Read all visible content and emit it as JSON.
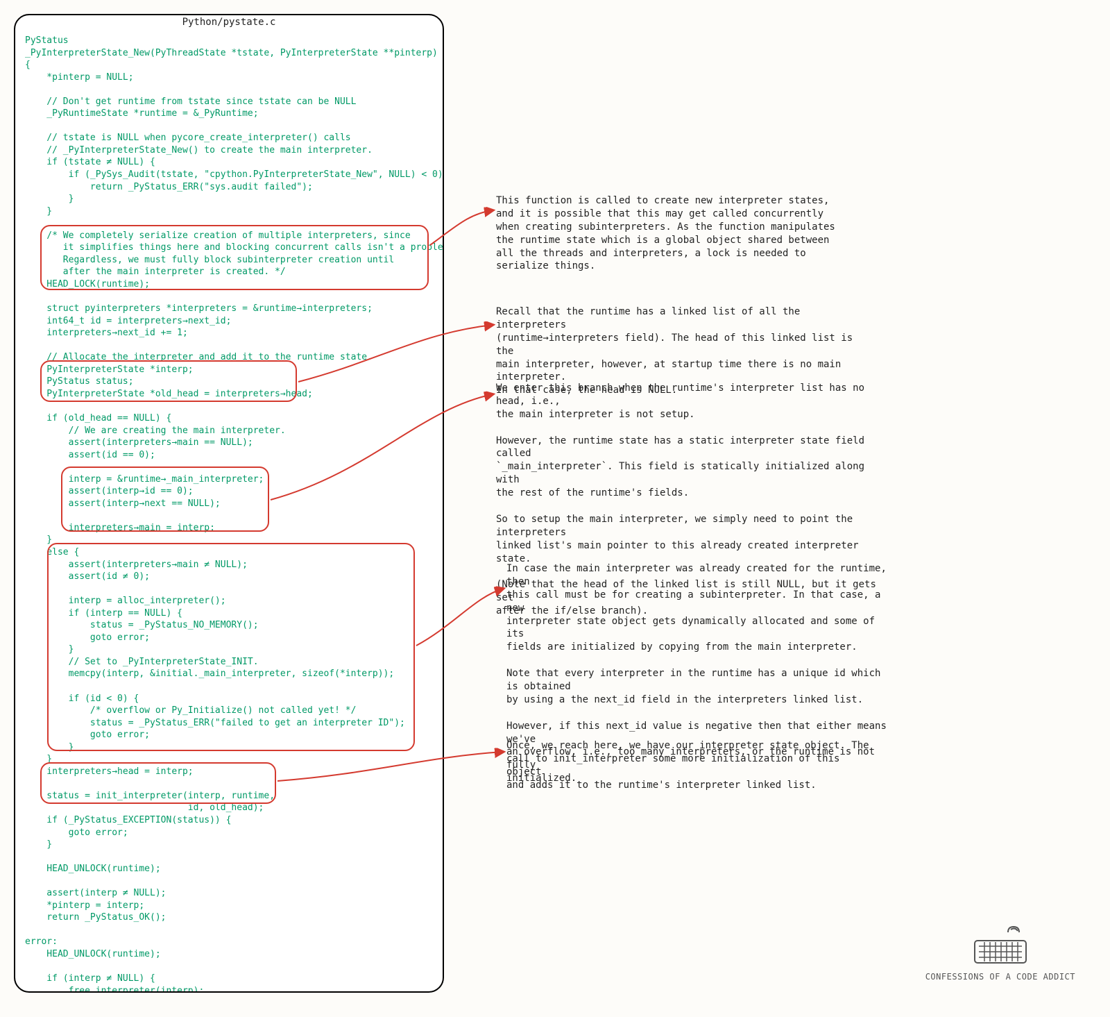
{
  "file_title": "Python/pystate.c",
  "code": "PyStatus\n_PyInterpreterState_New(PyThreadState *tstate, PyInterpreterState **pinterp)\n{\n    *pinterp = NULL;\n\n    // Don't get runtime from tstate since tstate can be NULL\n    _PyRuntimeState *runtime = &_PyRuntime;\n\n    // tstate is NULL when pycore_create_interpreter() calls\n    // _PyInterpreterState_New() to create the main interpreter.\n    if (tstate ≠ NULL) {\n        if (_PySys_Audit(tstate, \"cpython.PyInterpreterState_New\", NULL) < 0) {\n            return _PyStatus_ERR(\"sys.audit failed\");\n        }\n    }\n\n    /* We completely serialize creation of multiple interpreters, since\n       it simplifies things here and blocking concurrent calls isn't a problem.\n       Regardless, we must fully block subinterpreter creation until\n       after the main interpreter is created. */\n    HEAD_LOCK(runtime);\n\n    struct pyinterpreters *interpreters = &runtime→interpreters;\n    int64_t id = interpreters→next_id;\n    interpreters→next_id += 1;\n\n    // Allocate the interpreter and add it to the runtime state.\n    PyInterpreterState *interp;\n    PyStatus status;\n    PyInterpreterState *old_head = interpreters→head;\n\n    if (old_head == NULL) {\n        // We are creating the main interpreter.\n        assert(interpreters→main == NULL);\n        assert(id == 0);\n\n        interp = &runtime→_main_interpreter;\n        assert(interp→id == 0);\n        assert(interp→next == NULL);\n\n        interpreters→main = interp;\n    }\n    else {\n        assert(interpreters→main ≠ NULL);\n        assert(id ≠ 0);\n\n        interp = alloc_interpreter();\n        if (interp == NULL) {\n            status = _PyStatus_NO_MEMORY();\n            goto error;\n        }\n        // Set to _PyInterpreterState_INIT.\n        memcpy(interp, &initial._main_interpreter, sizeof(*interp));\n\n        if (id < 0) {\n            /* overflow or Py_Initialize() not called yet! */\n            status = _PyStatus_ERR(\"failed to get an interpreter ID\");\n            goto error;\n        }\n    }\n    interpreters→head = interp;\n\n    status = init_interpreter(interp, runtime,\n                              id, old_head);\n    if (_PyStatus_EXCEPTION(status)) {\n        goto error;\n    }\n\n    HEAD_UNLOCK(runtime);\n\n    assert(interp ≠ NULL);\n    *pinterp = interp;\n    return _PyStatus_OK();\n\nerror:\n    HEAD_UNLOCK(runtime);\n\n    if (interp ≠ NULL) {\n        free_interpreter(interp);\n    }\n    return status;\n}",
  "annotations": {
    "a1": "This function is called to create new interpreter states,\nand it is possible that this may get called concurrently\nwhen creating subinterpreters. As the function manipulates\nthe runtime state which is a global object shared between\nall the threads and interpreters, a lock is needed to\nserialize things.",
    "a2": "Recall that the runtime has a linked list of all the interpreters\n(runtime→interpreters field). The head of this linked list is the\nmain interpreter, however, at startup time there is no main interpreter.\nIn that case, the head is NULL.",
    "a3": "We enter this branch when the runtime's interpreter list has no head, i.e.,\nthe main interpreter is not setup.\n\nHowever, the runtime state has a static interpreter state field called\n`_main_interpreter`. This field is statically initialized along with\nthe rest of the runtime's fields.\n\nSo to setup the main interpreter, we simply need to point the interpreters\nlinked list's main pointer to this already created interpreter state.\n\n(Note that the head of the linked list is still NULL, but it gets set\nafter the if/else branch).",
    "a4": "In case the main interpreter was already created for the runtime, then\nthis call must be for creating a subinterpreter. In that case, a new\ninterpreter state object gets dynamically allocated and some of its\nfields are initialized by copying from the main interpreter.\n\nNote that every interpreter in the runtime has a unique id which is obtained\nby using a the next_id field in the interpreters linked list.\n\nHowever, if this next_id value is negative then that either means we've\nan overflow, i.e., too many interpreters, or the runtime is not fully\ninitialized.",
    "a5": "Once, we reach here, we have our interpreter state object. The\ncall to init_interpreter some more initialization of this object\nand adds it to the runtime's interpreter linked list.",
    "logo_caption": "CONFESSIONS OF A CODE ADDICT"
  }
}
